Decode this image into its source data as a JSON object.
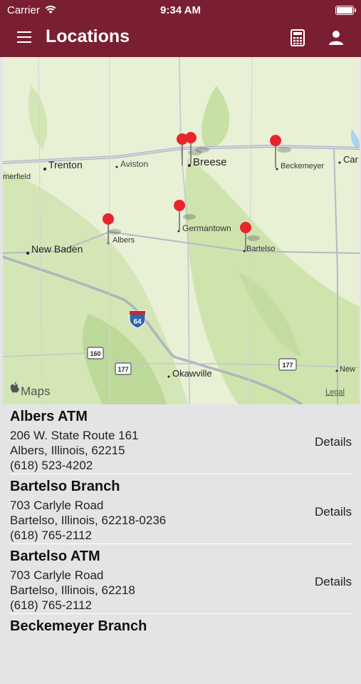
{
  "status": {
    "carrier": "Carrier",
    "time": "9:34 AM"
  },
  "nav": {
    "title": "Locations"
  },
  "map": {
    "brand": "Maps",
    "legal": "Legal",
    "labels": {
      "merfield": "merfield",
      "trenton": "Trenton",
      "aviston": "Aviston",
      "breese": "Breese",
      "beckemeyer": "Beckemeyer",
      "carlyle": "Car",
      "albers": "Albers",
      "germantown": "Germantown",
      "bartelso": "Bartelso",
      "newbaden": "New Baden",
      "okawville": "Okawville",
      "new": "New"
    },
    "shields": {
      "i64": "64",
      "r160": "160",
      "r177a": "177",
      "r177b": "177"
    }
  },
  "locations": [
    {
      "name": "Albers ATM",
      "address": "206 W. State Route 161",
      "city": "Albers, Illinois, 62215",
      "phone": "(618) 523-4202",
      "details": "Details"
    },
    {
      "name": "Bartelso Branch",
      "address": "703 Carlyle Road",
      "city": "Bartelso, Illinois, 62218-0236",
      "phone": "(618) 765-2112",
      "details": "Details"
    },
    {
      "name": "Bartelso ATM",
      "address": "703 Carlyle Road",
      "city": "Bartelso, Illinois, 62218",
      "phone": "(618) 765-2112",
      "details": "Details"
    },
    {
      "name": "Beckemeyer Branch",
      "address": "",
      "city": "",
      "phone": "",
      "details": ""
    }
  ],
  "colors": {
    "brand": "#7a1f32",
    "pin": "#e8262a"
  }
}
